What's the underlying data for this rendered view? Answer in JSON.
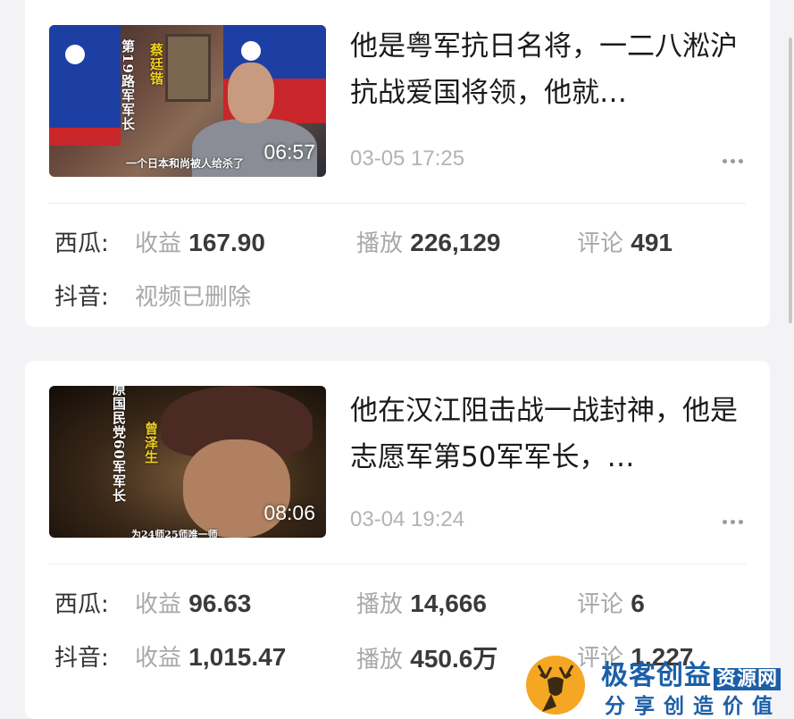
{
  "videos": [
    {
      "title": "他是粤军抗日名将，一二八淞沪抗战爱国将领，他就…",
      "duration": "06:57",
      "time": "03-05 17:25",
      "thumb_overlay": {
        "banner": "第19路军军长",
        "name": "蔡廷锴",
        "caption": "一个日本和尚被人给杀了"
      },
      "stats": [
        {
          "platform": "西瓜:",
          "deleted": null,
          "income_label": "收益",
          "income": "167.90",
          "plays_label": "播放",
          "plays": "226,129",
          "comments_label": "评论",
          "comments": "491"
        },
        {
          "platform": "抖音:",
          "deleted": "视频已删除"
        }
      ]
    },
    {
      "title": "他在汉江阻击战一战封神，他是志愿军第50军军长，…",
      "duration": "08:06",
      "time": "03-04 19:24",
      "thumb_overlay": {
        "banner": "原国民党60军军长",
        "name": "曾泽生",
        "caption": "为24师25师唯一师"
      },
      "stats": [
        {
          "platform": "西瓜:",
          "income_label": "收益",
          "income": "96.63",
          "plays_label": "播放",
          "plays": "14,666",
          "comments_label": "评论",
          "comments": "6"
        },
        {
          "platform": "抖音:",
          "income_label": "收益",
          "income": "1,015.47",
          "plays_label": "播放",
          "plays": "450.6万",
          "comments_label": "评论",
          "comments": "1,227"
        }
      ]
    }
  ],
  "watermark": {
    "title": "极客创益",
    "tag": "资源网",
    "subtitle": "分享创造价值"
  },
  "colors": {
    "background": "#f3f3f5",
    "card": "#ffffff",
    "muted": "#b3b3b3",
    "text": "#1a1a1a",
    "watermark_blue": "#1b5fa8"
  }
}
